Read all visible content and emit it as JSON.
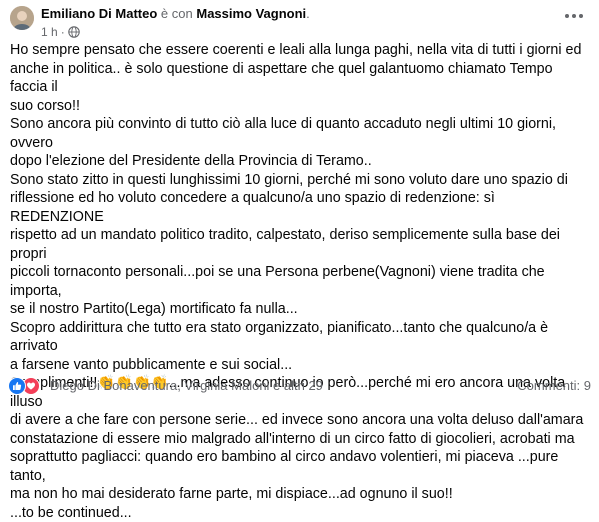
{
  "header": {
    "author": "Emiliano Di Matteo",
    "with_text": "è con",
    "tagged": "Massimo Vagnoni",
    "period": ".",
    "time": "1 h",
    "separator": "·"
  },
  "body": {
    "lines": [
      "Ho sempre pensato che essere coerenti e leali alla lunga paghi, nella vita di tutti i giorni ed",
      "anche in politica.. è solo questione di aspettare che quel galantuomo chiamato Tempo faccia il",
      "suo corso!!",
      "Sono ancora più convinto di tutto ciò alla luce di quanto accaduto negli ultimi 10 giorni, ovvero",
      "dopo l'elezione del Presidente della Provincia di Teramo..",
      "Sono stato zitto in questi lunghissimi 10 giorni, perché mi sono voluto dare uno spazio di",
      "riflessione ed ho voluto concedere a qualcuno/a uno spazio di redenzione: sì REDENZIONE",
      "rispetto ad un mandato politico tradito, calpestato, deriso semplicemente sulla base dei propri",
      "piccoli tornaconto personali...poi se una Persona perbene(Vagnoni) viene tradita che importa,",
      "se il nostro Partito(Lega) mortificato fa nulla...",
      "Scopro addirittura che tutto era stato organizzato, pianificato...tanto che qualcuno/a è arrivato",
      "a farsene vanto pubblicamente e sui social...",
      "Complimenti!!👏👏👏👏...ma adesso continuo io però...perché mi ero ancora una volta illuso",
      "di avere a che fare con persone serie... ed invece sono ancora una volta deluso dall'amara",
      "constatazione di essere mio malgrado all'interno di un circo fatto di giocolieri, acrobati ma",
      "soprattutto pagliacci: quando ero bambino al circo andavo volentieri, mi piaceva ...pure tanto,",
      "ma non ho mai desiderato farne parte, mi dispiace...ad ognuno il suo!!",
      "...to be continued..."
    ]
  },
  "footer": {
    "reactors": "Diego Di Bonaventura, Virginia Maloni e altri 29",
    "comments": "Commenti: 9"
  },
  "icons": {
    "more": "more-dots-icon",
    "audience": "globe-icon",
    "like": "like-icon",
    "love": "love-icon"
  },
  "colors": {
    "like": "#1877f2",
    "love": "#f33e58",
    "secondary_text": "#65676b"
  }
}
